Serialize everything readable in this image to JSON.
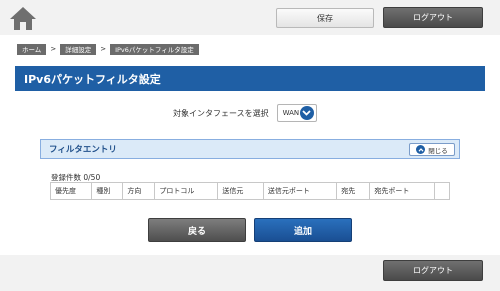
{
  "header": {
    "home_icon": "home-icon",
    "save_label": "保存",
    "logout_label": "ログアウト"
  },
  "breadcrumb": {
    "items": [
      "ホーム",
      "詳細設定",
      "IPv6パケットフィルタ設定"
    ],
    "separator": ">"
  },
  "page": {
    "title": "IPv6パケットフィルタ設定"
  },
  "interface_select": {
    "label": "対象インタフェースを選択",
    "value": "WAN"
  },
  "filter_section": {
    "title": "フィルタエントリ",
    "close_label": "閉じる",
    "count_text": "登録件数 0/50",
    "columns": [
      "優先度",
      "種別",
      "方向",
      "プロトコル",
      "送信元",
      "送信元ポート",
      "宛先",
      "宛先ポート",
      ""
    ]
  },
  "actions": {
    "back_label": "戻る",
    "add_label": "追加"
  },
  "footer": {
    "logout_label": "ログアウト"
  },
  "colors": {
    "accent": "#1f5fa5",
    "section_head_bg": "#dbeaf8",
    "dark_button": "#5a5a5a"
  }
}
